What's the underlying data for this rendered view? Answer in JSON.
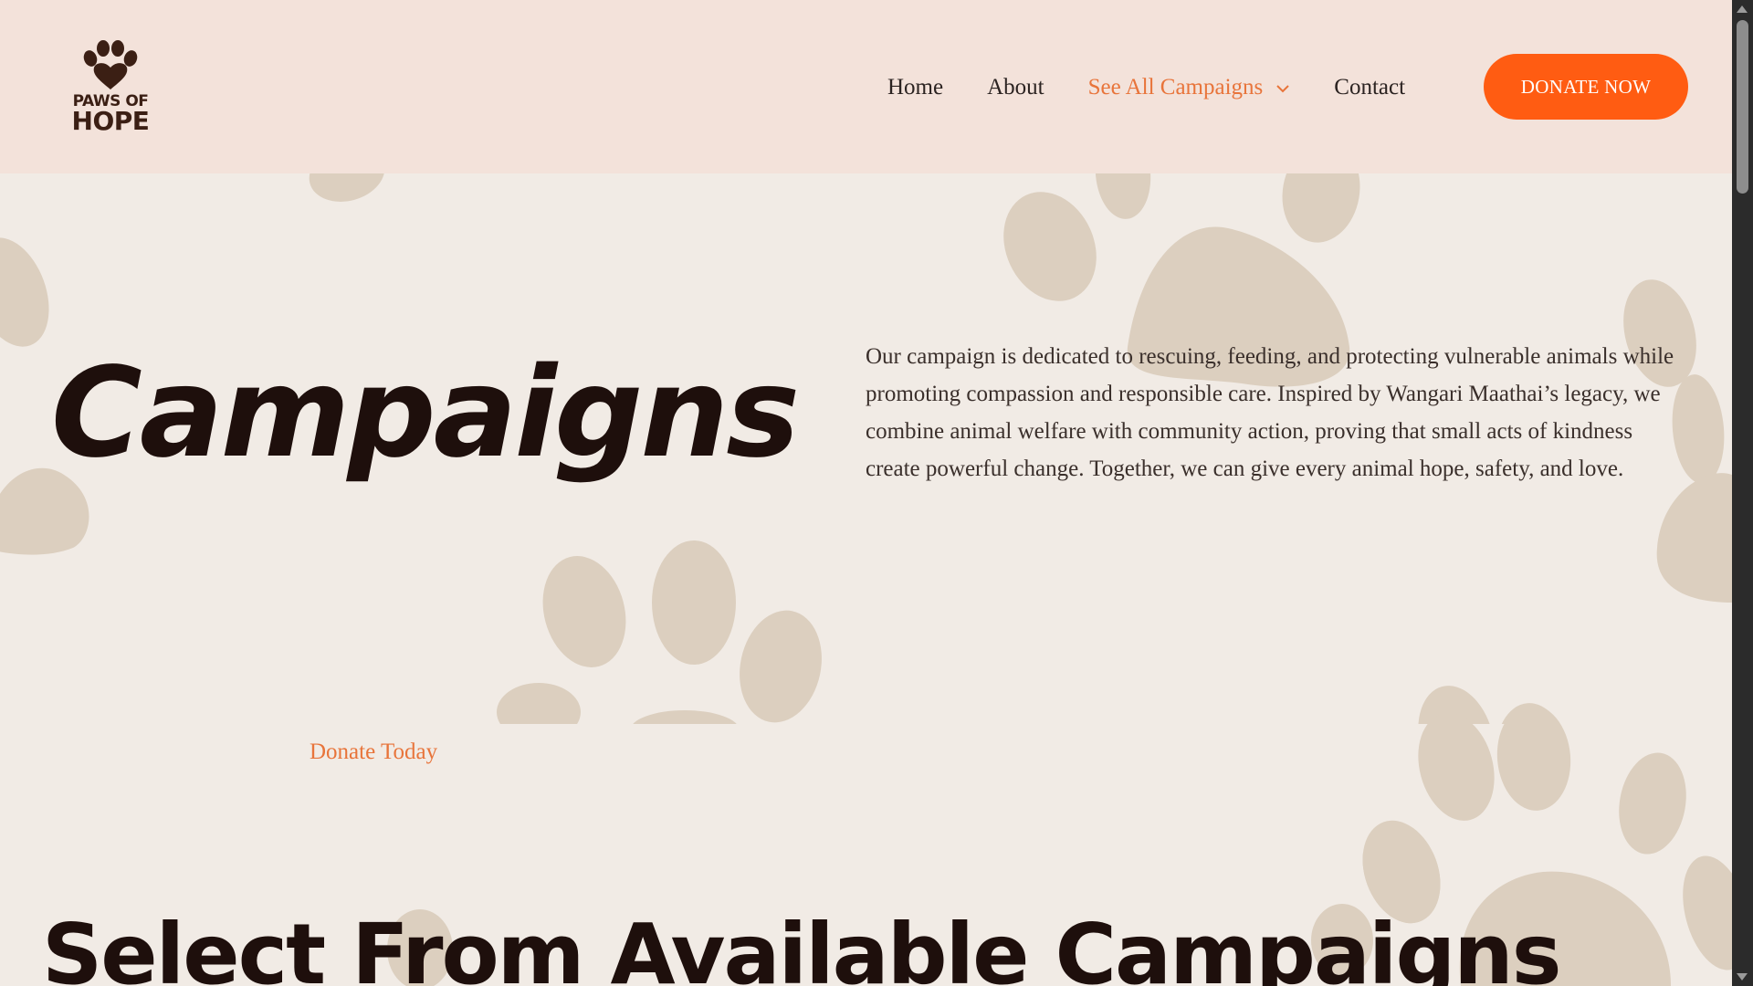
{
  "brand": {
    "logo_line1": "PAWS OF",
    "logo_line2": "HOPE",
    "logo_color": "#3b1f14"
  },
  "nav": {
    "items": [
      {
        "label": "Home"
      },
      {
        "label": "About"
      },
      {
        "label": "See All Campaigns",
        "active": true,
        "has_dropdown": true
      },
      {
        "label": "Contact"
      }
    ],
    "donate_label": "DONATE NOW"
  },
  "hero": {
    "title": "Campaigns",
    "description": "Our campaign is dedicated to rescuing, feeding, and protecting vulnerable animals while promoting compassion and responsible care. Inspired by Wangari Maathai’s legacy, we combine animal welfare with community action, proving that small acts of kindness create powerful change. Together, we can give every animal hope, safety, and love."
  },
  "donate_link": "Donate Today",
  "section": {
    "title": "Select From Available Campaigns"
  },
  "colors": {
    "accent": "#ff5c12",
    "accent_text": "#e8743a",
    "header_bg": "#f3e2da",
    "page_bg": "#f1ebe5",
    "paw": "#dccfbf"
  },
  "icons": [
    "paw-heart-icon",
    "chevron-down-icon"
  ]
}
